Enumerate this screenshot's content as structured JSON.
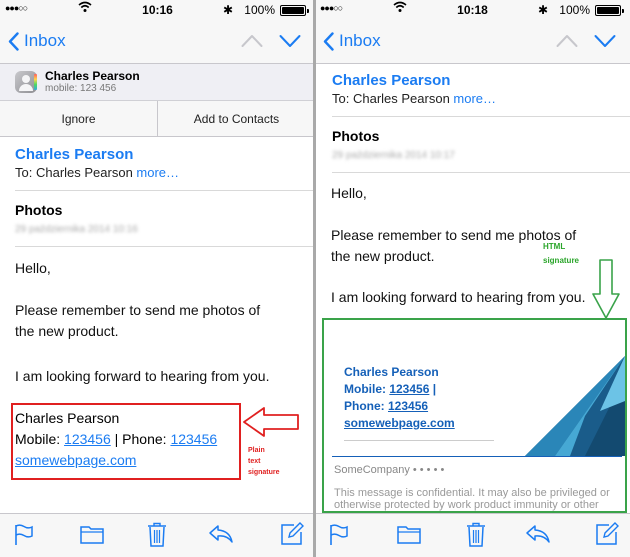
{
  "status": {
    "left": {
      "signal": "●●●○○",
      "time": "10:16",
      "battery": "100%"
    },
    "right": {
      "signal": "●●●○○",
      "time": "10:18",
      "battery": "100%"
    }
  },
  "nav": {
    "back_label": "Inbox"
  },
  "contact_banner": {
    "name": "Charles Pearson",
    "mobile": "mobile: 123 456",
    "ignore": "Ignore",
    "add": "Add to Contacts"
  },
  "email": {
    "sender": "Charles Pearson",
    "to_prefix": "To: ",
    "to_name": "Charles Pearson ",
    "more": "more…",
    "subject": "Photos",
    "date_left": "29 października 2014 10:16",
    "date_right": "29 października 2014 10:17",
    "greeting": "Hello,",
    "line1a": "Please remember to send me photos of",
    "line1b": "the new product.",
    "line2": "I am looking forward to hearing from you."
  },
  "plain_signature": {
    "name": "Charles Pearson",
    "mobile_label": "Mobile:  ",
    "mobile": "123456",
    "sep": " | Phone: ",
    "phone": "123456",
    "web": "somewebpage.com",
    "annotation": [
      "Plain",
      "text",
      "signature"
    ]
  },
  "html_signature": {
    "annotation": [
      "HTML",
      "signature"
    ],
    "name": "Charles Pearson",
    "mobile_label": "Mobile:  ",
    "mobile": "123456",
    "mobile_tail": " |",
    "phone_label": "Phone: ",
    "phone": "123456",
    "web": "somewebpage.com",
    "company": "SomeCompany • •   • • •",
    "confidential": "This message is confidential. It may also be privileged or otherwise protected by work product immunity or other legal rules. If you"
  },
  "colors": {
    "accent": "#1b7cf2",
    "plain_annotation": "#e02020",
    "html_annotation": "#3aa34a",
    "signature_blue": "#1560b8"
  }
}
